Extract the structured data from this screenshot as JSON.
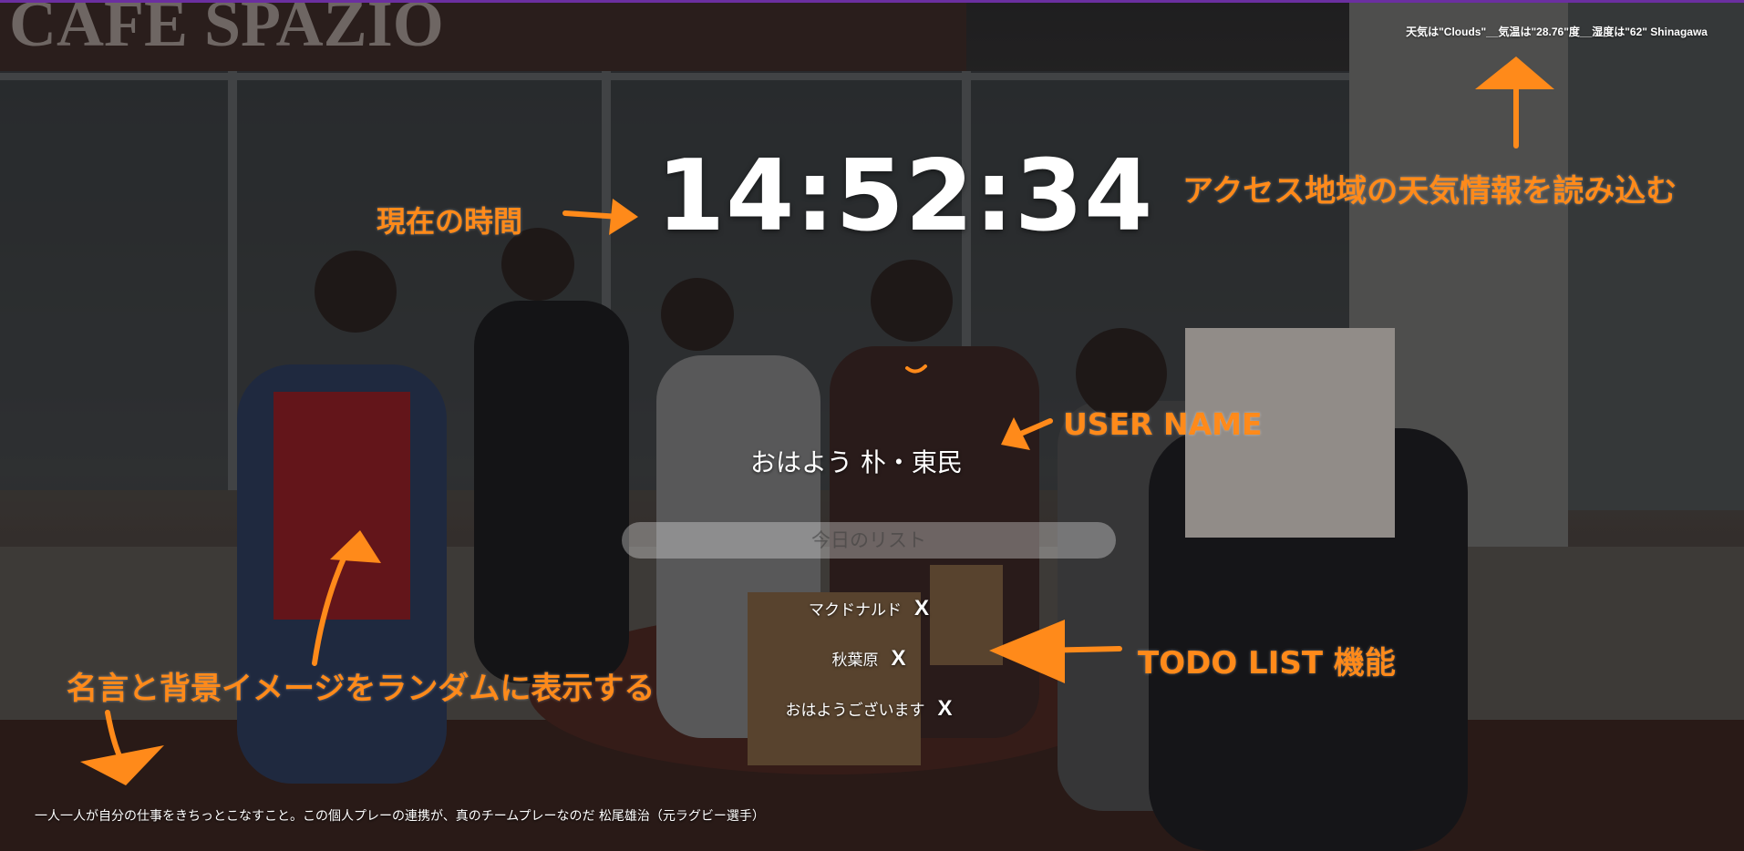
{
  "weather": {
    "text": "天気は\"Clouds\"__気温は\"28.76\"度__湿度は\"62\" Shinagawa"
  },
  "clock": {
    "time": "14:52:34"
  },
  "greeting": {
    "text": "おはよう 朴・東民"
  },
  "todo": {
    "placeholder": "今日のリスト",
    "delete_label": "X",
    "items": [
      {
        "text": "マクドナルド"
      },
      {
        "text": "秋葉原"
      },
      {
        "text": "おはようございます"
      }
    ]
  },
  "quote": {
    "text": "一人一人が自分の仕事をきちっとこなすこと。この個人プレーの連携が、真のチームプレーなのだ 松尾雄治（元ラグビー選手）"
  },
  "annotations": {
    "clock": "現在の時間",
    "weather": "アクセス地域の天気情報を読み込む",
    "user": "USER NAME",
    "todo": "TODO LIST 機能",
    "quote": "名言と背景イメージをランダムに表示する"
  },
  "background": {
    "sign_text": "CAFE SPAZIO"
  },
  "colors": {
    "annotation": "#ff8a1a",
    "text": "#ffffff",
    "accent_bar": "#6b2fa0"
  }
}
